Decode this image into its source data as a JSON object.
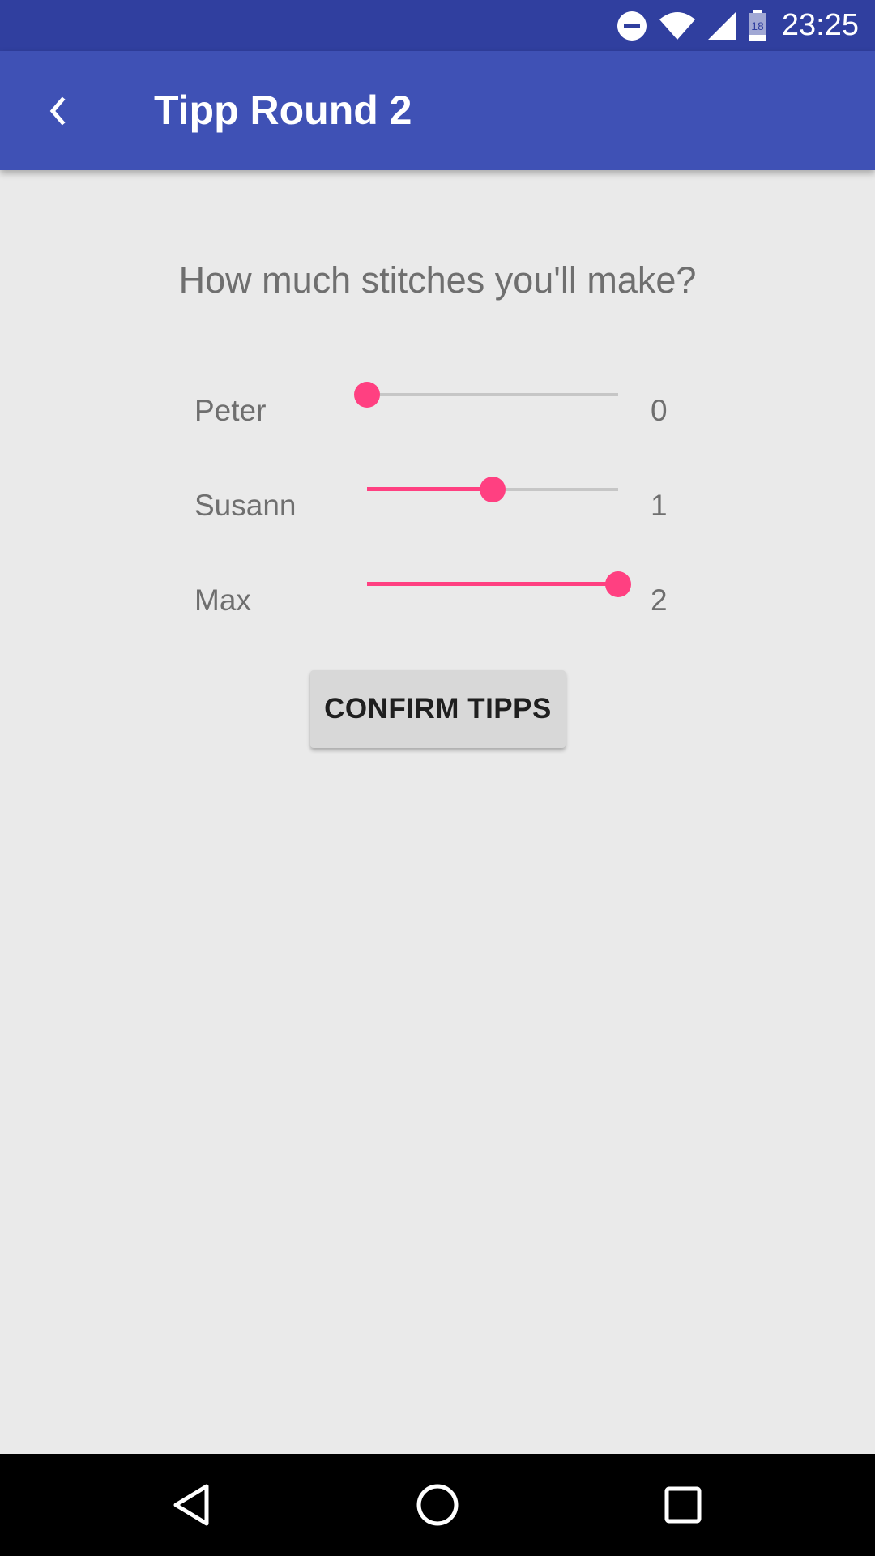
{
  "status_bar": {
    "time": "23:25",
    "battery_level": "18",
    "icons": [
      "do-not-disturb-icon",
      "wifi-icon",
      "cell-signal-icon",
      "battery-icon"
    ]
  },
  "app_bar": {
    "title": "Tipp Round 2",
    "back_icon": "back-chevron-icon",
    "color": "#3f51b5"
  },
  "main": {
    "question": "How much stitches you'll make?",
    "slider_max": 2,
    "accent_color": "#ff4081",
    "players": [
      {
        "name": "Peter",
        "value": "0"
      },
      {
        "name": "Susann",
        "value": "1"
      },
      {
        "name": "Max",
        "value": "2"
      }
    ],
    "confirm_label": "CONFIRM TIPPS"
  },
  "nav_bar": {
    "icons": [
      "back-triangle-icon",
      "home-circle-icon",
      "recents-square-icon"
    ]
  }
}
